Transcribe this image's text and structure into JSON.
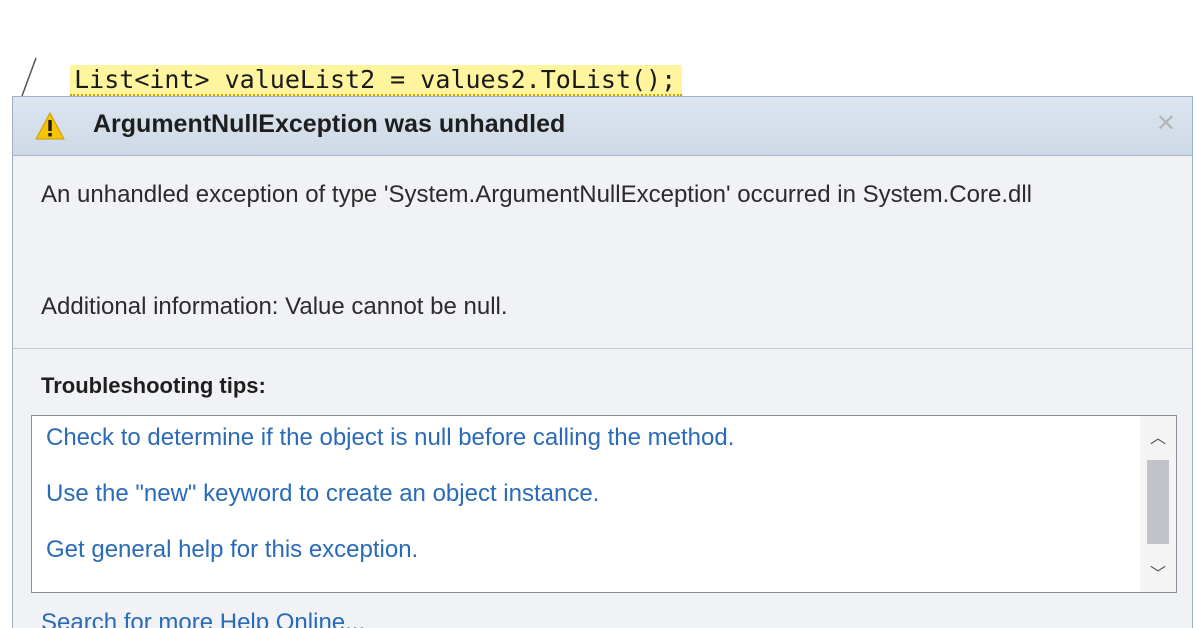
{
  "code": {
    "line": "List<int> valueList2 = values2.ToList();"
  },
  "exception": {
    "title": "ArgumentNullException was unhandled",
    "message": "An unhandled exception of type 'System.ArgumentNullException' occurred in System.Core.dll",
    "additional_info": "Additional information: Value cannot be null.",
    "warning_icon": "warning-triangle-icon",
    "close_icon": "close-icon"
  },
  "troubleshooting": {
    "heading": "Troubleshooting tips:",
    "tips": [
      "Check to determine if the object is null before calling the method.",
      "Use the \"new\" keyword to create an object instance.",
      "Get general help for this exception."
    ]
  },
  "links": {
    "search_online": "Search for more Help Online..."
  },
  "colors": {
    "highlight": "#fff59e",
    "link": "#2a6bb8",
    "warning": "#f5c400",
    "header": "#d3dde9"
  }
}
